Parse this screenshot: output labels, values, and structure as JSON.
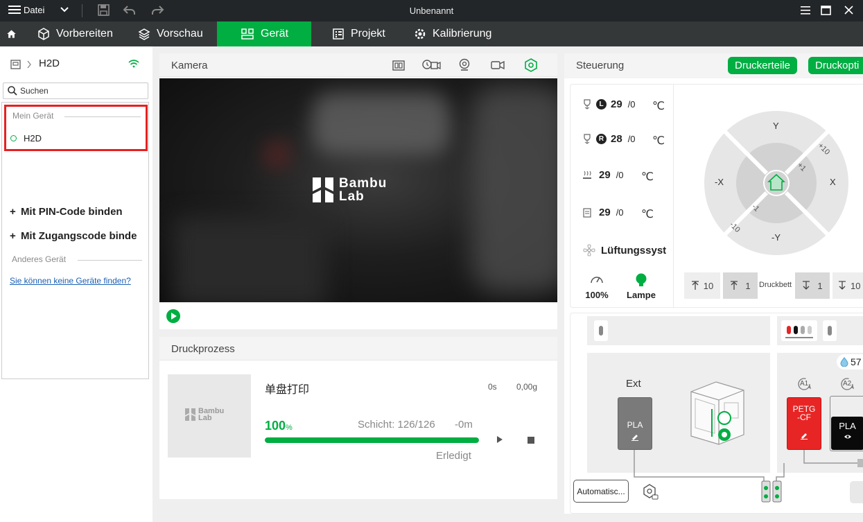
{
  "titlebar": {
    "file_menu": "Datei",
    "title": "Unbenannt"
  },
  "nav": {
    "prepare": "Vorbereiten",
    "preview": "Vorschau",
    "device": "Gerät",
    "project": "Projekt",
    "calibration": "Kalibrierung"
  },
  "left": {
    "device_name": "H2D",
    "search_placeholder": "Suchen",
    "my_device_header": "Mein Gerät",
    "my_device_item": "H2D",
    "bind_pin": "Mit PIN-Code binden",
    "bind_access": "Mit Zugangscode binde",
    "other_device_header": "Anderes Gerät",
    "help_link": "Sie können keine Geräte finden?"
  },
  "camera": {
    "title": "Kamera",
    "logo_line1": "Bambu",
    "logo_line2": "Lab"
  },
  "print": {
    "title": "Druckprozess",
    "thumb_line1": "Bambu",
    "thumb_line2": "Lab",
    "job_name": "单盘打印",
    "time": "0s",
    "weight": "0,00g",
    "percent": "100",
    "percent_unit": "%",
    "progress": 1.0,
    "layer": "Schicht: 126/126",
    "remaining": "-0m",
    "status": "Erledigt"
  },
  "control": {
    "title": "Steuerung",
    "btn_parts": "Druckerteile",
    "btn_options": "Druckopti",
    "nozzle_left_badge": "L",
    "nozzle_left_cur": "29",
    "nozzle_left_tgt": "/0",
    "nozzle_right_badge": "R",
    "nozzle_right_cur": "28",
    "nozzle_right_tgt": "/0",
    "bed_cur": "29",
    "bed_tgt": "/0",
    "chamber_cur": "29",
    "chamber_tgt": "/0",
    "unit": "℃",
    "fan_label": "Lüftungssyst",
    "speed_value": "100%",
    "lamp_label": "Lampe",
    "jog": {
      "y_pos": "Y",
      "y_neg": "-Y",
      "x_pos": "X",
      "x_neg": "-X",
      "plus10": "+10",
      "plus1": "+1",
      "minus1": "-1",
      "minus10": "-10"
    },
    "bed_up10": "10",
    "bed_up1": "1",
    "bed_label": "Druckbett",
    "bed_down1": "1",
    "bed_down10": "10"
  },
  "filament": {
    "ext_label": "Ext",
    "ext_material": "PLA",
    "slot_a1": "A1",
    "slot_a2": "A2",
    "a1_material_1": "PETG",
    "a1_material_2": "-CF",
    "a2_material": "PLA",
    "humidity": "57",
    "auto_button": "Automatisc...",
    "colors": {
      "ext": "#7a7a7a",
      "a1": "#e82525",
      "a2": "#0a0a0a",
      "accent": "#00ae42"
    }
  }
}
